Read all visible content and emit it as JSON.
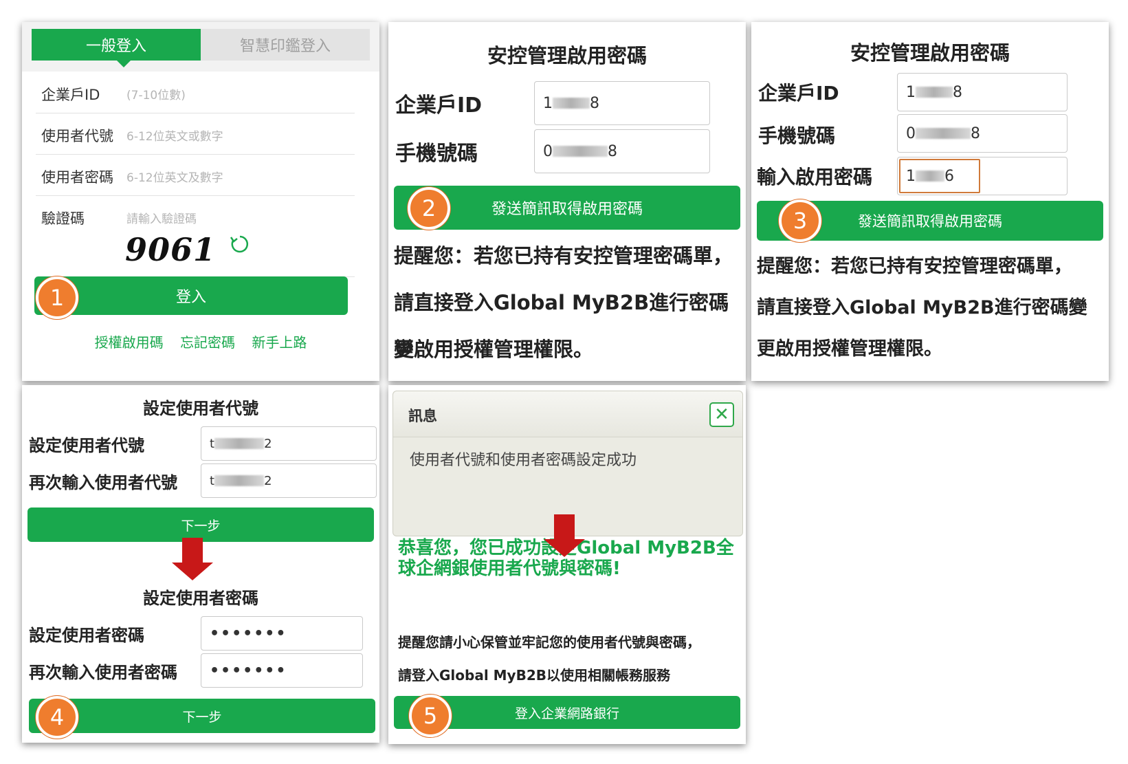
{
  "panel1": {
    "tab_general": "一般登入",
    "tab_smart": "智慧印鑑登入",
    "rows": [
      {
        "label": "企業戶ID",
        "placeholder": "(7-10位數)"
      },
      {
        "label": "使用者代號",
        "placeholder": "6-12位英文或數字"
      },
      {
        "label": "使用者密碼",
        "placeholder": "6-12位英文及數字"
      },
      {
        "label": "驗證碼",
        "placeholder": "請輸入驗證碼"
      }
    ],
    "captcha": "9061",
    "login_button": "登入",
    "links": [
      "授權啟用碼",
      "忘記密碼",
      "新手上路"
    ],
    "step": "1"
  },
  "panel2": {
    "title": "安控管理啟用密碼",
    "id_label": "企業戶ID",
    "id_start": "1",
    "id_end": "8",
    "phone_label": "手機號碼",
    "phone_start": "0",
    "phone_end": "8",
    "send_button": "發送簡訊取得啟用密碼",
    "step": "2",
    "notice_1": "提醒您：若您已持有安控管理密碼單，",
    "notice_2": "請直接登入Global MyB2B進行密碼變",
    "notice_3": "更啟用授權管理權限。"
  },
  "panel3": {
    "title": "安控管理啟用密碼",
    "id_label": "企業戶ID",
    "id_start": "1",
    "id_end": "8",
    "phone_label": "手機號碼",
    "phone_start": "0",
    "phone_end": "8",
    "code_label": "輸入啟用密碼",
    "code_start": "1",
    "code_end": "6",
    "send_button": "發送簡訊取得啟用密碼",
    "step": "3",
    "notice_1": "提醒您：若您已持有安控管理密碼單，",
    "notice_2": "請直接登入Global MyB2B進行密碼變",
    "notice_3": "更啟用授權管理權限。"
  },
  "panel4": {
    "title_userid": "設定使用者代號",
    "set_userid_label": "設定使用者代號",
    "confirm_userid_label": "再次輸入使用者代號",
    "userid_start": "t",
    "userid_end": "2",
    "next_button_1": "下一步",
    "title_password": "設定使用者密碼",
    "set_password_label": "設定使用者密碼",
    "confirm_password_label": "再次輸入使用者密碼",
    "password_mask": "•••••••",
    "next_button_2": "下一步",
    "step": "4"
  },
  "panel5": {
    "dialog_title": "訊息",
    "dialog_message": "使用者代號和使用者密碼設定成功",
    "congrats": "恭喜您，您已成功設定Global MyB2B全球企網銀使用者代號與密碼!",
    "reminder_1": "提醒您請小心保管並牢記您的使用者代號與密碼，",
    "reminder_2": "請登入Global MyB2B以使用相關帳務服務",
    "login_bank_button": "登入企業網路銀行",
    "step": "5"
  },
  "colors": {
    "brand_green": "#19a84d",
    "step_badge": "#ef7d2e",
    "arrow": "#c81818"
  }
}
